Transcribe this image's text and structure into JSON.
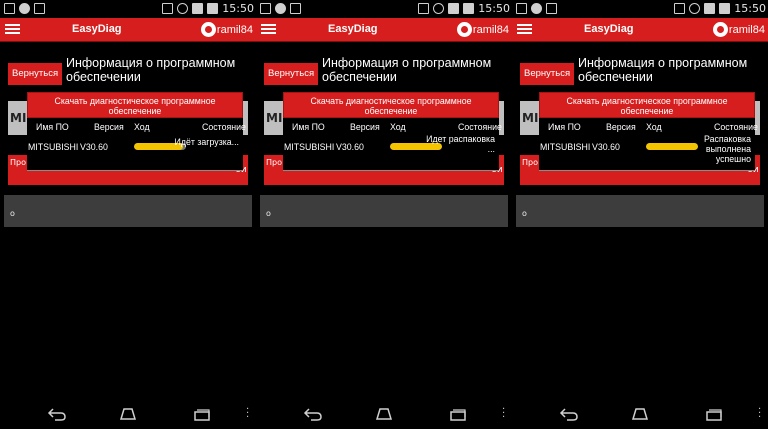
{
  "screens": [
    {
      "status_time": "15:50",
      "app_title": "EasyDiag",
      "username": "ramil84",
      "back_label": "Вернуться",
      "page_title": "Информация о программном обеспечении",
      "bg_tile_text": "MI",
      "bg_red_text": "Про ны",
      "bg_red_right": "ои",
      "bg_gray_text": "о",
      "dialog_title": "Скачать диагностическое программное обеспечение",
      "columns": [
        "Имя ПО",
        "Версия",
        "Ход",
        "Состояние"
      ],
      "row": {
        "name": "MITSUBISHI",
        "version": "V30.60",
        "progress": 0.95,
        "status": "Идёт загрузка..."
      }
    },
    {
      "status_time": "15:50",
      "app_title": "EasyDiag",
      "username": "ramil84",
      "back_label": "Вернуться",
      "page_title": "Информация о программном обеспечении",
      "bg_tile_text": "MI",
      "bg_red_text": "Про ны",
      "bg_red_right": "ои",
      "bg_gray_text": "о",
      "dialog_title": "Скачать диагностическое программное обеспечение",
      "columns": [
        "Имя ПО",
        "Версия",
        "Ход",
        "Состояние"
      ],
      "row": {
        "name": "MITSUBISHI",
        "version": "V30.60",
        "progress": 1.0,
        "status": "Идет распаковка ..."
      }
    },
    {
      "status_time": "15:50",
      "app_title": "EasyDiag",
      "username": "ramil84",
      "back_label": "Вернуться",
      "page_title": "Информация о программном обеспечении",
      "bg_tile_text": "MI",
      "bg_red_text": "Про ны",
      "bg_red_right": "ои",
      "bg_gray_text": "о",
      "dialog_title": "Скачать диагностическое программное обеспечение",
      "columns": [
        "Имя ПО",
        "Версия",
        "Ход",
        "Состояние"
      ],
      "row": {
        "name": "MITSUBISHI",
        "version": "V30.60",
        "progress": 1.0,
        "status": "Распаковка выполнена успешно"
      }
    }
  ],
  "colors": {
    "accent": "#d71e1e",
    "progress": "#f5c400",
    "track": "#777777"
  }
}
